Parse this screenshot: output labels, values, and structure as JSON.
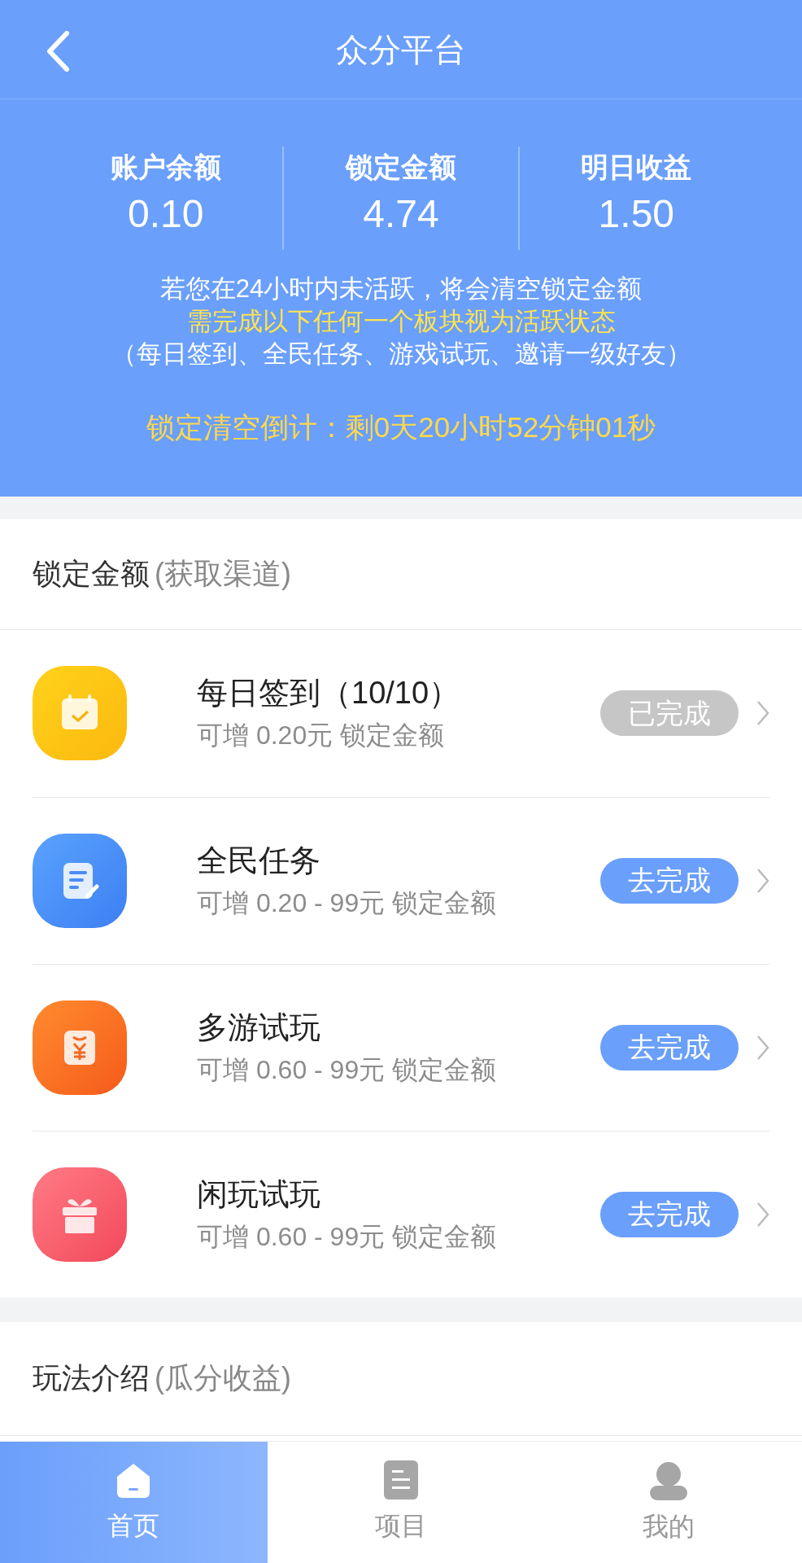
{
  "header": {
    "title": "众分平台"
  },
  "stats": [
    {
      "label": "账户余额",
      "value": "0.10"
    },
    {
      "label": "锁定金额",
      "value": "4.74"
    },
    {
      "label": "明日收益",
      "value": "1.50"
    }
  ],
  "notice": [
    {
      "text": "若您在24小时内未活跃，将会清空锁定金额",
      "highlight": false
    },
    {
      "text": "需完成以下任何一个板块视为活跃状态",
      "highlight": true
    },
    {
      "text": "（每日签到、全民任务、游戏试玩、邀请一级好友）",
      "highlight": false
    }
  ],
  "countdown": "锁定清空倒计：剩0天20小时52分钟01秒",
  "channels": {
    "title": "锁定金额",
    "subtitle": "(获取渠道)",
    "items": [
      {
        "kind": "calendar",
        "name": "每日签到（10/10）",
        "reward": "可增 0.20元 锁定金额",
        "button": "已完成",
        "done": true
      },
      {
        "kind": "document",
        "name": "全民任务",
        "reward": "可增 0.20 - 99元 锁定金额",
        "button": "去完成",
        "done": false
      },
      {
        "kind": "wallet",
        "name": "多游试玩",
        "reward": "可增 0.60 - 99元 锁定金额",
        "button": "去完成",
        "done": false
      },
      {
        "kind": "gift",
        "name": "闲玩试玩",
        "reward": "可增 0.60 - 99元 锁定金额",
        "button": "去完成",
        "done": false
      }
    ]
  },
  "intro": {
    "title": "玩法介绍",
    "subtitle": "(瓜分收益)"
  },
  "tabbar": [
    {
      "kind": "home",
      "label": "首页",
      "selected": true
    },
    {
      "kind": "list",
      "label": "项目",
      "selected": false
    },
    {
      "kind": "user",
      "label": "我的",
      "selected": false
    }
  ]
}
